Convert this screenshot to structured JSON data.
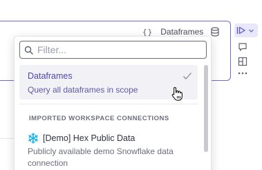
{
  "cell_header": {
    "braces": "{}",
    "source_label": "Dataframes"
  },
  "dropdown": {
    "search": {
      "value": "",
      "placeholder": "Filter..."
    },
    "selected_option": {
      "title": "Dataframes",
      "subtitle": "Query all dataframes in scope"
    },
    "section_heading": "IMPORTED WORKSPACE CONNECTIONS",
    "connections": [
      {
        "name": "[Demo] Hex Public Data",
        "description": "Publicly available demo Snowflake data connection",
        "icon": "snowflake-icon"
      }
    ]
  },
  "toolbar": {
    "icons": [
      "run-cell-icon",
      "chevron-down-icon",
      "comment-icon",
      "layout-icon",
      "more-options-icon"
    ]
  },
  "colors": {
    "accent": "#6f6acb",
    "selected_text": "#4d48b0",
    "snowflake": "#29b5e8"
  }
}
